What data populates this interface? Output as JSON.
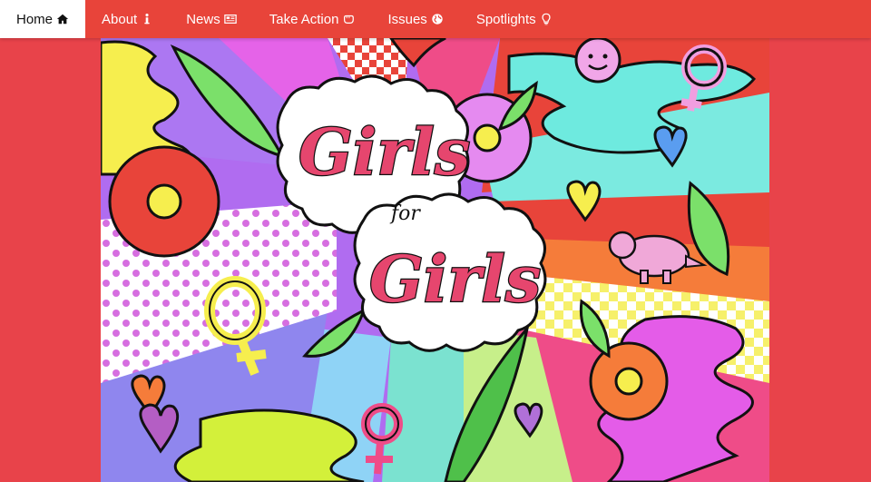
{
  "nav": {
    "items": [
      {
        "label": "Home",
        "icon": "home-icon",
        "active": true
      },
      {
        "label": "About",
        "icon": "info-icon",
        "active": false
      },
      {
        "label": "News",
        "icon": "newspaper-icon",
        "active": false
      },
      {
        "label": "Take Action",
        "icon": "hand-icon",
        "active": false
      },
      {
        "label": "Issues",
        "icon": "globe-icon",
        "active": false
      },
      {
        "label": "Spotlights",
        "icon": "lightbulb-icon",
        "active": false
      }
    ]
  },
  "hero": {
    "title_line1": "Girls",
    "title_for": "for",
    "title_line2": "Girls"
  },
  "colors": {
    "nav_bg": "#e8443a",
    "page_bg": "#e8434a",
    "title_pink": "#e6466e"
  }
}
